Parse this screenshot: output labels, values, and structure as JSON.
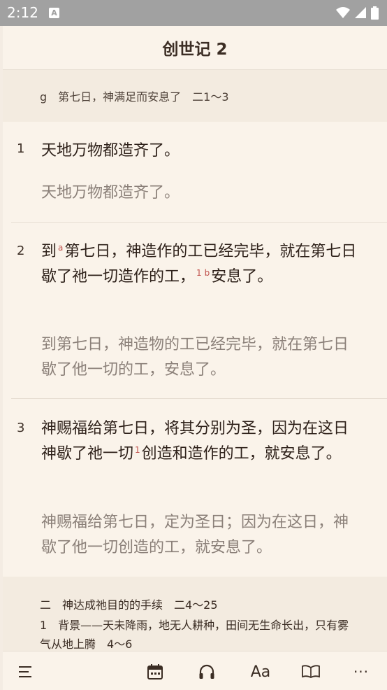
{
  "status": {
    "time": "2:12",
    "a_label": "A"
  },
  "header": {
    "title": "创世记 2"
  },
  "section": {
    "text": "g　第七日，神满足而安息了　二1～3"
  },
  "verses": [
    {
      "num": "1",
      "main": "天地万物都造齐了。",
      "alt": "天地万物都造齐了。"
    },
    {
      "num": "2",
      "p1": "到",
      "s1": "a",
      "p2": "第七日，神造作的工已经完毕，就在第七日歇了祂一切造作的工，",
      "s2": "1",
      "s3": "b",
      "p3": "安息了。",
      "alt": "到第七日，神造物的工已经完毕，就在第七日歇了他一切的工，安息了。"
    },
    {
      "num": "3",
      "p1": "神赐福给第七日，将其分别为圣，因为在这日神歇了祂一切",
      "s1": "1",
      "p2": "创造和造作的工，就安息了。",
      "alt": "神赐福给第七日，定为圣日；因为在这日，神歇了他一切创造的工，就安息了。"
    }
  ],
  "outline": {
    "line1": "二　神达成祂目的的手续　二4～25",
    "line2": "1　背景——天未降雨，地无人耕种，田间无生命长出，只有雾气从地上腾　4～6"
  },
  "nav": {
    "font_label": "Aa",
    "more_label": "···"
  }
}
